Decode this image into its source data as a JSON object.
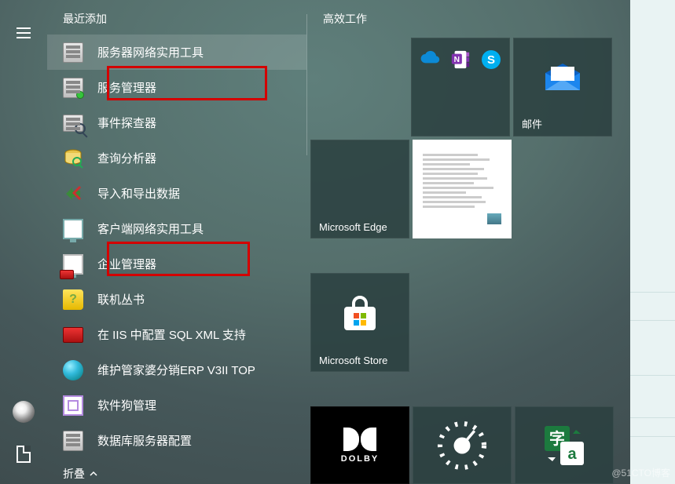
{
  "section_header": "最近添加",
  "collapse_label": "折叠",
  "app_items": [
    {
      "label": "服务器网络实用工具",
      "icon": "server-network"
    },
    {
      "label": "服务管理器",
      "icon": "server-manager"
    },
    {
      "label": "事件探查器",
      "icon": "profiler"
    },
    {
      "label": "查询分析器",
      "icon": "query-analyzer"
    },
    {
      "label": "导入和导出数据",
      "icon": "dts"
    },
    {
      "label": "客户端网络实用工具",
      "icon": "client-network"
    },
    {
      "label": "企业管理器",
      "icon": "enterprise-manager"
    },
    {
      "label": "联机丛书",
      "icon": "books-online"
    },
    {
      "label": "在 IIS 中配置 SQL XML 支持",
      "icon": "iis-sqlxml"
    },
    {
      "label": "维护管家婆分销ERP V3II TOP",
      "icon": "maintain-erp"
    },
    {
      "label": "软件狗管理",
      "icon": "dongle-manager"
    },
    {
      "label": "数据库服务器配置",
      "icon": "db-server-config"
    }
  ],
  "tiles": {
    "group_label": "高效工作",
    "mail_label": "邮件",
    "edge_label": "Microsoft Edge",
    "store_label": "Microsoft Store"
  },
  "colors": {
    "highlight": "#d40000",
    "mail_blue": "#0078d4",
    "onedrive_blue": "#0c8ad6",
    "onenote_purple": "#8233b0",
    "skype_blue": "#00aff0"
  },
  "watermark": "@51CTO博客"
}
